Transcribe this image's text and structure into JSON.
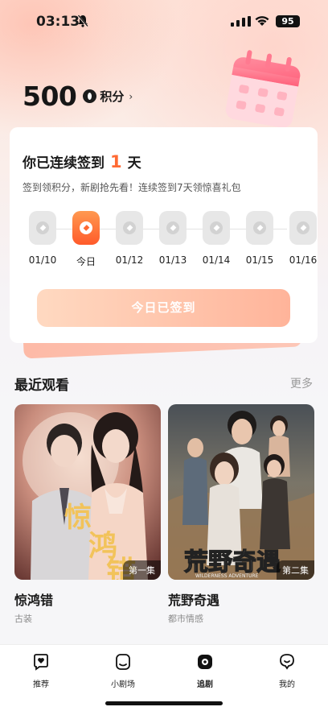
{
  "status_bar": {
    "time": "03:13",
    "battery": "95"
  },
  "points": {
    "value": "500",
    "label": "积分",
    "arrow": "›"
  },
  "checkin": {
    "title_prefix": "你已连续签到",
    "streak": "1",
    "title_suffix": "天",
    "subtitle": "签到领积分，新剧抢先看！连续签到7天领惊喜礼包",
    "days": [
      {
        "label": "01/10",
        "today": false
      },
      {
        "label": "今日",
        "today": true
      },
      {
        "label": "01/12",
        "today": false
      },
      {
        "label": "01/13",
        "today": false
      },
      {
        "label": "01/14",
        "today": false
      },
      {
        "label": "01/15",
        "today": false
      },
      {
        "label": "01/16",
        "today": false
      }
    ],
    "button_label": "今日已签到"
  },
  "recent": {
    "title": "最近观看",
    "more": "更多",
    "items": [
      {
        "title": "惊鸿错",
        "genre": "古装",
        "episode": "第一集",
        "poster_text": "惊鸿错"
      },
      {
        "title": "荒野奇遇",
        "genre": "都市情感",
        "episode": "第二集",
        "poster_text": "荒野奇遇",
        "poster_subtext": "WILDERNESS ADVENTURE"
      }
    ]
  },
  "nav": {
    "items": [
      {
        "label": "推荐",
        "icon": "heart-chat-icon"
      },
      {
        "label": "小剧场",
        "icon": "theater-icon"
      },
      {
        "label": "追剧",
        "icon": "follow-icon",
        "active": true
      },
      {
        "label": "我的",
        "icon": "profile-icon"
      }
    ]
  },
  "colors": {
    "accent": "#ff6a33",
    "button_start": "#ffd9c1",
    "button_end": "#ffb49a"
  }
}
